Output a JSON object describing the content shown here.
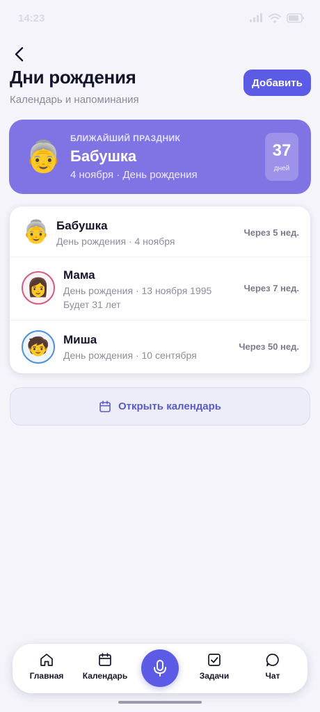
{
  "status_bar": {
    "time": "14:23",
    "icons": [
      "signal-icon",
      "wifi-icon",
      "battery-icon"
    ]
  },
  "header": {
    "back_icon": "back-arrow-icon",
    "title": "Дни рождения",
    "subtitle": "Календарь и напоминания",
    "add_label": "Добавить"
  },
  "featured": {
    "eyebrow": "БЛИЖАЙШИЙ ПРАЗДНИК",
    "emoji": "👵",
    "name": "Бабушка",
    "date_line": "4 ноября · День рождения",
    "days_count": "37",
    "days_label": "дней"
  },
  "birthdays": [
    {
      "emoji": "👵",
      "name": "Бабушка",
      "detail": "День рождения · 4 ноября",
      "extra": "",
      "countdown": "Через 5 нед."
    },
    {
      "emoji": "👩",
      "name": "Мама",
      "detail": "День рождения · 13 ноября 1995",
      "extra": "Будет 31 лет",
      "countdown": "Через 7 нед."
    },
    {
      "emoji": "🧒",
      "name": "Миша",
      "detail": "День рождения · 10 сентября",
      "extra": "",
      "countdown": "Через 50 нед."
    }
  ],
  "calendar_button": {
    "icon": "calendar-icon",
    "label": "Открыть календарь"
  },
  "nav": {
    "home": "Главная",
    "calendar": "Календарь",
    "tasks": "Задачи",
    "chat": "Чат",
    "mic_icon": "microphone-icon"
  },
  "colors": {
    "accent": "#5b5be6",
    "hero_background": "#8074e4",
    "page_background": "#f4f4fa"
  }
}
